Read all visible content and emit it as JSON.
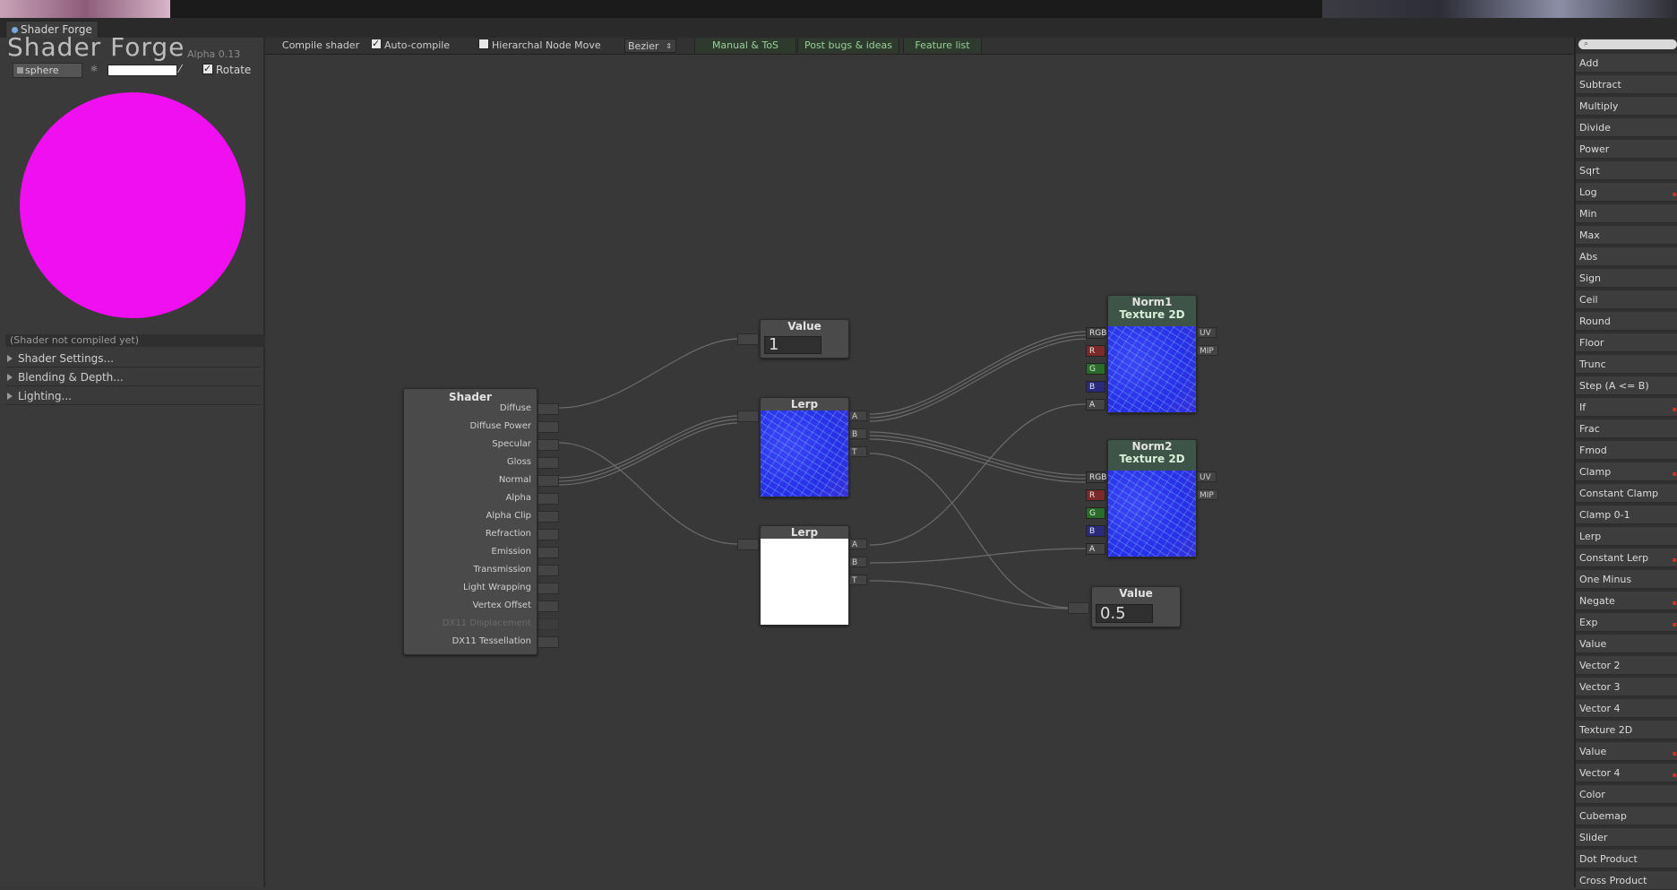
{
  "window": {
    "tab_title": "Shader Forge"
  },
  "left_panel": {
    "brand": "Shader Forge",
    "version": "Alpha 0.13",
    "mesh": "sphere",
    "rotate_label": "Rotate",
    "status": "(Shader not compiled yet)",
    "foldouts": [
      "Shader Settings...",
      "Blending & Depth...",
      "Lighting..."
    ],
    "preview_color": "#f00ff0"
  },
  "toolbar": {
    "compile": "Compile shader",
    "auto_compile": "Auto-compile",
    "hierarchal": "Hierarchal Node Move",
    "curve_mode": "Bezier",
    "manual": "Manual & ToS",
    "bugs": "Post bugs & ideas",
    "features": "Feature list"
  },
  "nodes": {
    "shader": {
      "title": "Shader",
      "inputs": [
        "Diffuse",
        "Diffuse Power",
        "Specular",
        "Gloss",
        "Normal",
        "Alpha",
        "Alpha Clip",
        "Refraction",
        "Emission",
        "Transmission",
        "Light Wrapping",
        "Vertex Offset",
        "DX11 Displacement",
        "DX11 Tessellation"
      ]
    },
    "value1": {
      "title": "Value",
      "value": "1"
    },
    "lerp1": {
      "title": "Lerp",
      "ports": [
        "A",
        "B",
        "T"
      ]
    },
    "lerp2": {
      "title": "Lerp",
      "ports": [
        "A",
        "B",
        "T"
      ]
    },
    "norm1": {
      "name": "Norm1",
      "title": "Texture 2D",
      "left_ports": [
        "RGB",
        "R",
        "G",
        "B",
        "A"
      ],
      "right_ports": [
        "UV",
        "MIP"
      ]
    },
    "norm2": {
      "name": "Norm2",
      "title": "Texture 2D",
      "left_ports": [
        "RGB",
        "R",
        "G",
        "B",
        "A"
      ],
      "right_ports": [
        "UV",
        "MIP"
      ]
    },
    "value2": {
      "title": "Value",
      "value": "0.5"
    }
  },
  "node_list": {
    "search_placeholder": "",
    "items": [
      "Add",
      "Subtract",
      "Multiply",
      "Divide",
      "Power",
      "Sqrt",
      "Log",
      "Min",
      "Max",
      "Abs",
      "Sign",
      "Ceil",
      "Round",
      "Floor",
      "Trunc",
      "Step (A <= B)",
      "If",
      "Frac",
      "Fmod",
      "Clamp",
      "Constant Clamp",
      "Clamp 0-1",
      "Lerp",
      "Constant Lerp",
      "One Minus",
      "Negate",
      "Exp",
      "Value",
      "Vector 2",
      "Vector 3",
      "Vector 4",
      "Texture 2D",
      "Value",
      "Vector 4",
      "Color",
      "Cubemap",
      "Slider",
      "Dot Product",
      "Cross Product"
    ]
  },
  "colors": {
    "accent_link": "#9acf9a",
    "wire": "#6a6a6a",
    "texture_blue": "#2f38ee",
    "channel_r": "#8a2a2a",
    "channel_g": "#2a7a2a",
    "channel_b": "#2a2a8a"
  }
}
